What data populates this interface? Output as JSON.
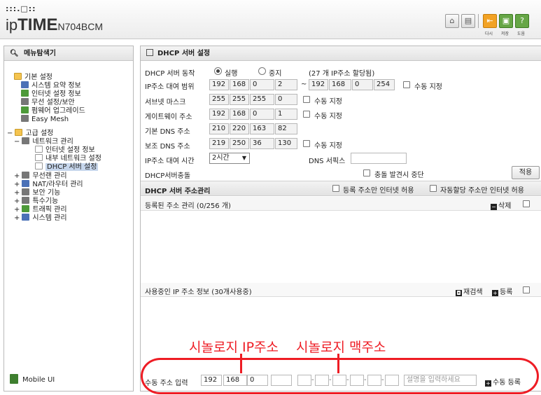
{
  "header": {
    "dots": ":::.□::",
    "brand_prefix": "ip",
    "brand_bold": "TIME",
    "model": "N704BCM",
    "buttons": [
      {
        "name": "home-icon",
        "label": ""
      },
      {
        "name": "window-icon",
        "label": ""
      },
      {
        "name": "logout-icon",
        "label": "다시"
      },
      {
        "name": "save-icon",
        "label": "저장"
      },
      {
        "name": "help-icon",
        "label": "도움"
      }
    ],
    "help_glyph": "?"
  },
  "sidebar": {
    "title": "메뉴탐색기",
    "items": [
      {
        "label": "기본 설정",
        "icon": "folder"
      },
      {
        "label": "시스템 요약 정보",
        "icon": "blue"
      },
      {
        "label": "인터넷 설정 정보",
        "icon": "green"
      },
      {
        "label": "무선 설정/보안",
        "icon": "gray"
      },
      {
        "label": "펌웨어 업그레이드",
        "icon": "green"
      },
      {
        "label": "Easy Mesh",
        "icon": "gray"
      },
      {
        "label": "고급 설정",
        "icon": "folder"
      },
      {
        "label": "네트워크 관리",
        "icon": "gray"
      },
      {
        "label": "인터넷 설정 정보",
        "icon": "page"
      },
      {
        "label": "내부 네트워크 설정",
        "icon": "page"
      },
      {
        "label": "DHCP 서버 설정",
        "icon": "page"
      },
      {
        "label": "무선랜 관리",
        "icon": "gray"
      },
      {
        "label": "NAT/라우터 관리",
        "icon": "blue"
      },
      {
        "label": "보안 기능",
        "icon": "gray"
      },
      {
        "label": "특수기능",
        "icon": "gray"
      },
      {
        "label": "트래픽 관리",
        "icon": "green"
      },
      {
        "label": "시스템 관리",
        "icon": "blue"
      }
    ],
    "mobile_label": "Mobile UI"
  },
  "main": {
    "title": "DHCP 서버 설정",
    "rows": {
      "dhcp_action": {
        "label": "DHCP 서버 동작",
        "run": "실행",
        "stop": "중지",
        "note": "(27 개 IP주소 할당됨)"
      },
      "ip_range": {
        "label": "IP주소 대여 범위",
        "start": [
          "192",
          "168",
          "0",
          "2"
        ],
        "sep": "~",
        "end": [
          "192",
          "168",
          "0",
          "254"
        ],
        "manual": "수동 지정"
      },
      "subnet": {
        "label": "서브넷 마스크",
        "values": [
          "255",
          "255",
          "255",
          "0"
        ],
        "manual": "수동 지정"
      },
      "gateway": {
        "label": "게이트웨이 주소",
        "values": [
          "192",
          "168",
          "0",
          "1"
        ],
        "manual": "수동 지정"
      },
      "dns1": {
        "label": "기본 DNS 주소",
        "values": [
          "210",
          "220",
          "163",
          "82"
        ]
      },
      "dns2": {
        "label": "보조 DNS 주소",
        "values": [
          "219",
          "250",
          "36",
          "130"
        ],
        "manual": "수동 지정"
      },
      "lease": {
        "label": "IP주소 대여 시간",
        "select": "2시간",
        "dns_suffix": "DNS 서픽스"
      },
      "conflict": {
        "label": "DHCP서버충돌",
        "stop_on_conflict": "충돌 발견시 중단",
        "apply": "적용"
      }
    },
    "addr_section": {
      "title": "DHCP 서버 주소관리",
      "opt1": "등록 주소만 인터넷 허용",
      "opt2": "자동할당 주소만 인터넷 허용"
    },
    "registered": {
      "label": "등록된 주소 관리 (0/256 개)",
      "delete": "삭제"
    },
    "in_use": {
      "label": "사용중인 IP 주소 정보 (30개사용중)",
      "rescan": "재검색",
      "register": "등록"
    },
    "manual_entry": {
      "label": "수동 주소 입력",
      "ip": [
        "192",
        "168",
        "0",
        ""
      ],
      "mac": [
        "",
        "",
        "",
        "",
        "",
        ""
      ],
      "desc_placeholder": "설명을 입력하세요",
      "register": "수동 등록"
    }
  },
  "annotations": {
    "ip": "시놀로지 IP주소",
    "mac": "시놀로지 맥주소",
    "color": "#ee1c24"
  }
}
